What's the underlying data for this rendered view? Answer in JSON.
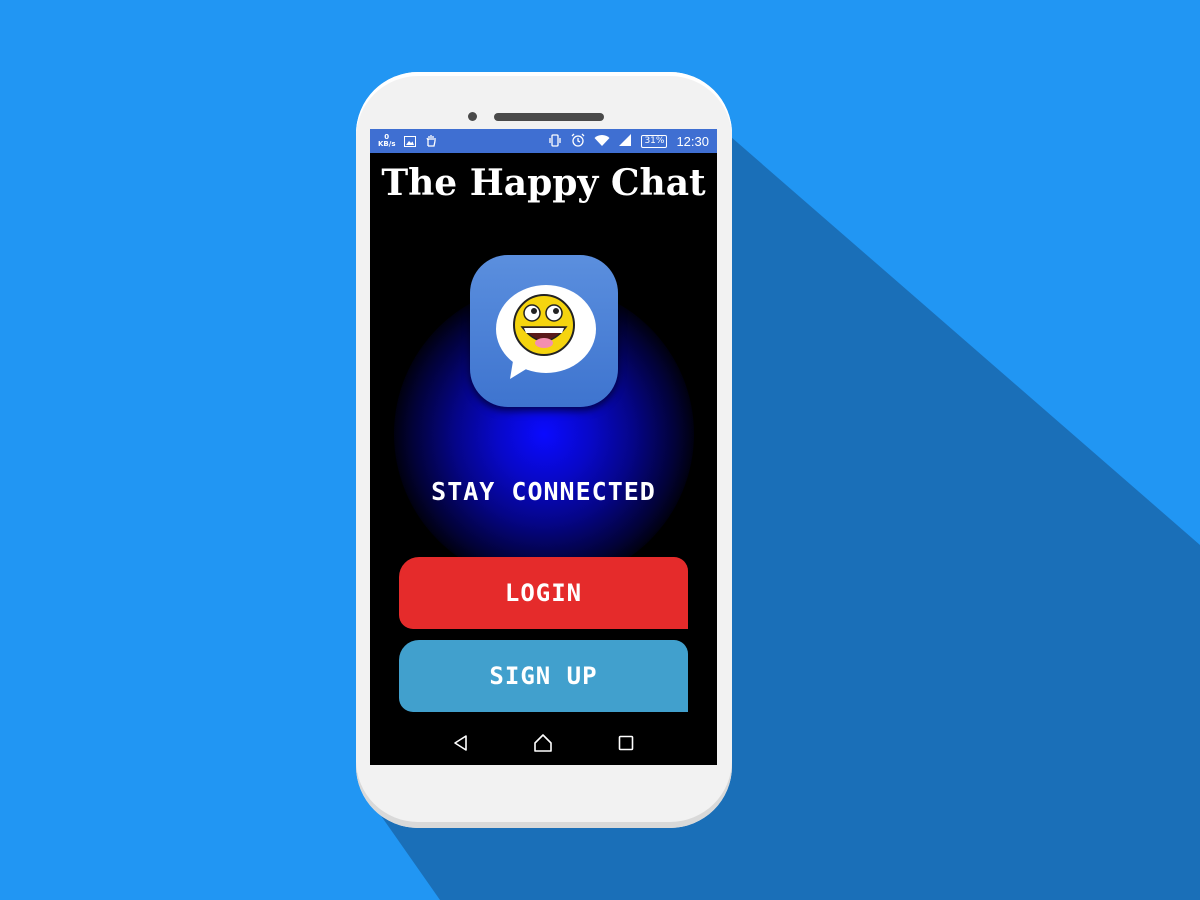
{
  "status_bar": {
    "net_speed_value": "0",
    "net_speed_unit": "KB/s",
    "battery": "31%",
    "time": "12:30",
    "left_icons": [
      "image-icon",
      "hand-icon"
    ],
    "right_icons": [
      "vibrate-icon",
      "alarm-icon",
      "wifi-icon",
      "signal-icon",
      "battery-icon"
    ]
  },
  "app": {
    "title": "The Happy Chat",
    "logo_icon": "happy-chat-bubble-icon",
    "tagline": "STAY CONNECTED",
    "login_label": "LOGIN",
    "signup_label": "SIGN UP"
  },
  "nav_bar": {
    "icons": [
      "back-icon",
      "home-icon",
      "recents-icon"
    ]
  },
  "colors": {
    "background": "#2196F3",
    "status_bar": "#3f6fd2",
    "login_button": "#e52b2b",
    "signup_button": "#41a0cd",
    "glow": "#0a0aff"
  }
}
